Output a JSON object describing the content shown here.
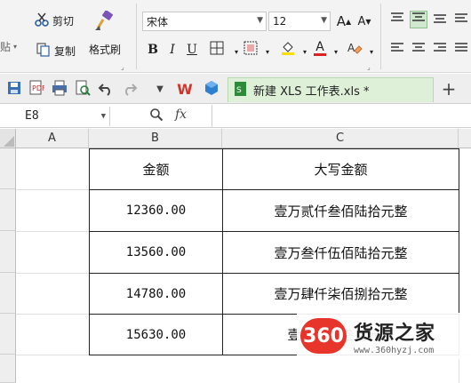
{
  "ribbon": {
    "paste_label": "贴",
    "cut_label": "剪切",
    "copy_label": "复制",
    "format_painter_label": "格式刷",
    "font_name": "宋体",
    "font_size": "12",
    "bold_label": "B",
    "italic_label": "I",
    "underline_label": "U",
    "grow_font_label": "A",
    "shrink_font_label": "A",
    "font_color_label": "A"
  },
  "tabbar": {
    "tab_label": "新建 XLS 工作表.xls *",
    "add_tab_label": "+",
    "wps_label": "W"
  },
  "formula_bar": {
    "cell_ref": "E8",
    "fx_label": "fx",
    "value": ""
  },
  "columns": [
    "A",
    "B",
    "C"
  ],
  "table": {
    "header": [
      "金额",
      "大写金额"
    ],
    "rows": [
      [
        "12360.00",
        "壹万贰仟叁佰陆拾元整"
      ],
      [
        "13560.00",
        "壹万叁仟伍佰陆拾元整"
      ],
      [
        "14780.00",
        "壹万肆仟柒佰捌拾元整"
      ],
      [
        "15630.00",
        "壹万伍佰叁拾元整"
      ]
    ]
  },
  "watermark": {
    "logo": "360",
    "title": "货源之家",
    "url": "www.360hyzj.com"
  },
  "colors": {
    "accent_green": "#2e8b3a",
    "tab_bg": "#dff0d8",
    "watermark_red": "#e8352b"
  }
}
